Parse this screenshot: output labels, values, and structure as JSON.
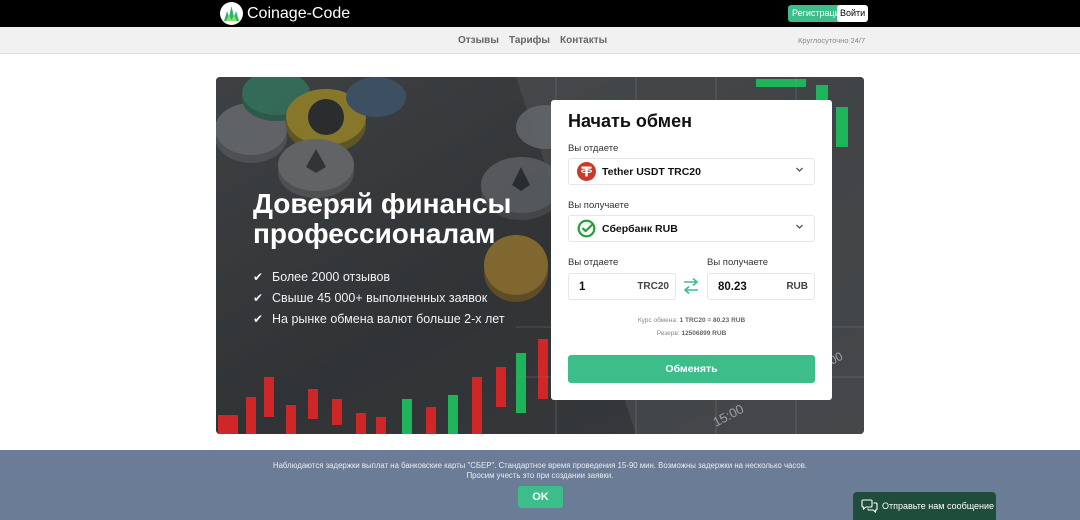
{
  "header": {
    "brand": "Coinage-Code",
    "register_label": "Регистрация",
    "login_label": "Войти"
  },
  "nav": {
    "items": [
      {
        "label": "Отзывы"
      },
      {
        "label": "Тарифы"
      },
      {
        "label": "Контакты"
      }
    ],
    "hours": "Круглосуточно 24/7"
  },
  "hero": {
    "title": "Доверяй финансы профессионалам",
    "features": [
      {
        "icon": "✔",
        "text": "Более 2000 отзывов"
      },
      {
        "icon": "✔",
        "text": "Свыше 45 000+ выполненных заявок"
      },
      {
        "icon": "✔",
        "text": "На рынке обмена валют больше 2-х лет"
      }
    ],
    "chart_time_labels": [
      "15:00",
      "00"
    ]
  },
  "exchange": {
    "title": "Начать обмен",
    "give_label": "Вы отдаете",
    "give_currency": "Tether USDT TRC20",
    "receive_label": "Вы получаете",
    "receive_currency": "Сбербанк RUB",
    "give_amount_label": "Вы отдаете",
    "give_amount": "1",
    "give_unit": "TRC20",
    "receive_amount_label": "Вы получаете",
    "receive_amount": "80.23",
    "receive_unit": "RUB",
    "rate_label": "Курс обмена:",
    "rate_value": "1 TRC20 = 80.23 RUB",
    "reserve_label": "Резерв:",
    "reserve_value": "12506899 RUB",
    "submit_label": "Обменять"
  },
  "notice": {
    "line1": "Наблюдаются задержки выплат на банковские карты \"СБЕР\". Стандартное время проведения 15-90 мин. Возможны задержки на несколько часов.",
    "line2": "Просим учесть это при создании заявки.",
    "ok_label": "OK"
  },
  "chat": {
    "label": "Отправьте нам сообщение"
  },
  "colors": {
    "accent": "#3dbd8a",
    "topbar": "#000000",
    "notice_bg": "#6b7c96",
    "chat_bg": "#1f4d3b",
    "tether": "#c9382b",
    "sber": "#21a038"
  },
  "icons": {
    "logo": "coinage-logo-icon",
    "tether": "tether-icon",
    "sber": "sberbank-icon",
    "chevron": "chevron-down-icon",
    "swap": "swap-arrows-icon",
    "chat": "chat-bubbles-icon"
  }
}
